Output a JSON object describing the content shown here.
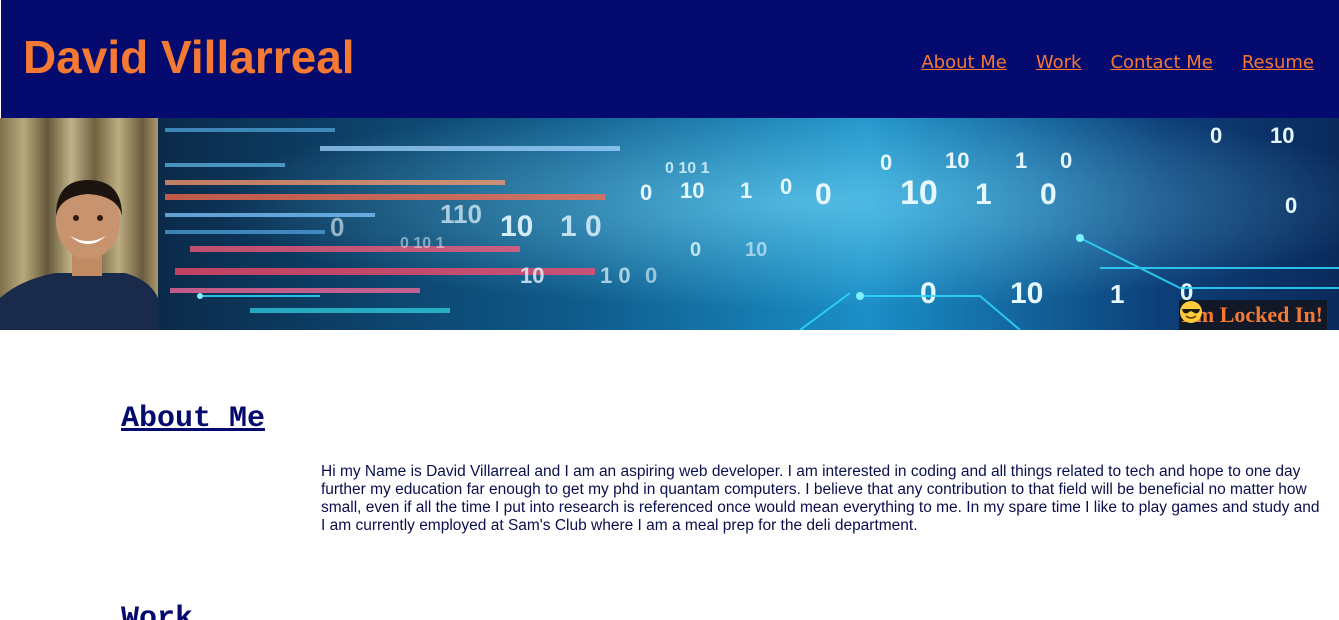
{
  "header": {
    "title": "David Villarreal",
    "nav": [
      {
        "label": "About Me"
      },
      {
        "label": "Work"
      },
      {
        "label": "Contact Me"
      },
      {
        "label": "Resume"
      }
    ]
  },
  "banner": {
    "tagline": "I'm Locked In!",
    "tagline_icon": "sunglasses-emoji-icon"
  },
  "about": {
    "heading": "About Me",
    "body": "Hi my Name is David Villarreal and I am an aspiring web developer. I am interested in coding and all things related to tech and hope to one day further my education far enough to get my phd in quantam computers. I believe that any contribution to that field will be beneficial no matter how small, even if all the time I put into research is referenced once would mean everything to me. In my spare time I like to play games and study and I am currently employed at Sam's Club where I am a meal prep for the deli department."
  },
  "work": {
    "heading": "Work"
  },
  "colors": {
    "header_bg": "#050a6e",
    "accent": "#f47933",
    "heading": "#050a6e"
  }
}
